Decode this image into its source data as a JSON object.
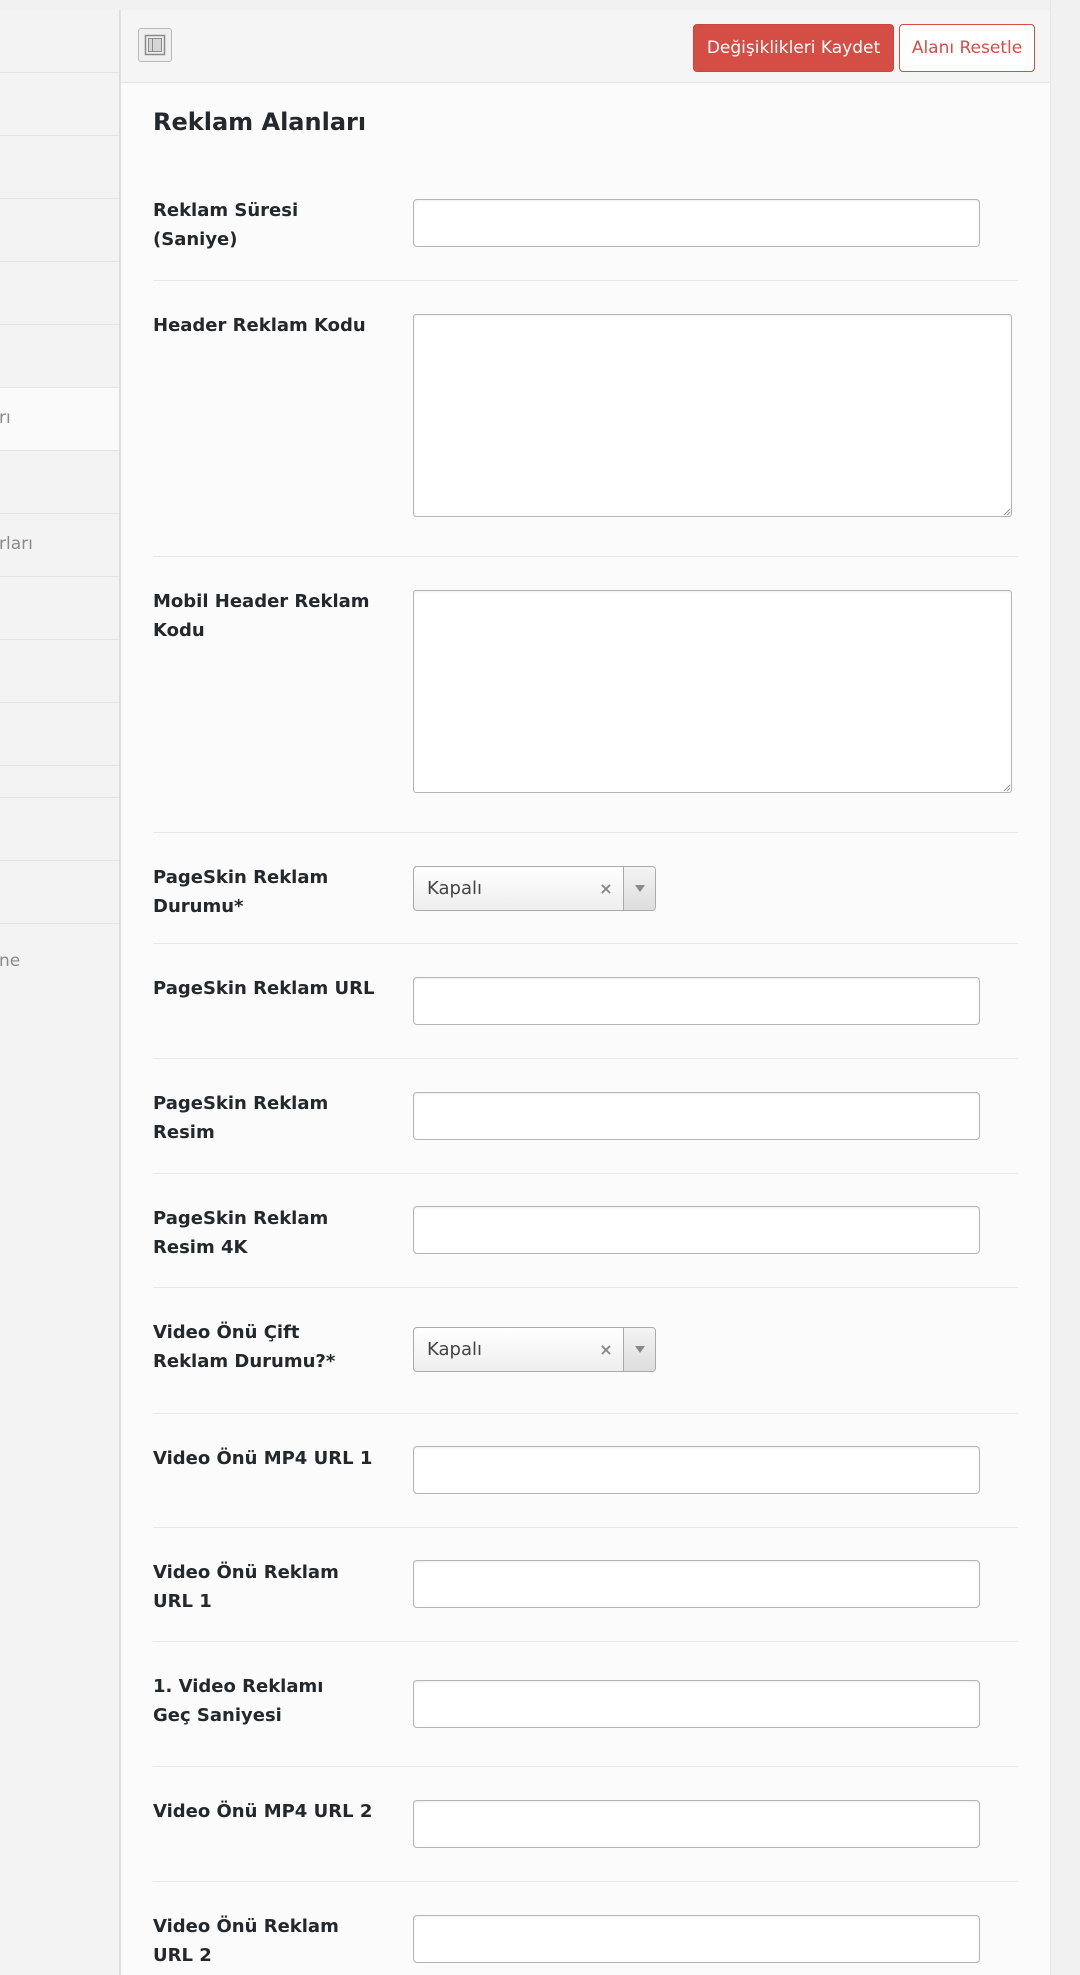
{
  "sidebar": {
    "fragments": [
      "rı",
      "rları",
      "ne"
    ]
  },
  "toolbar": {
    "save_label": "Değişiklikleri Kaydet",
    "reset_label": "Alanı Resetle"
  },
  "section": {
    "title": "Reklam Alanları"
  },
  "fields": {
    "reklam_suresi": {
      "label": "Reklam Süresi (Saniye)",
      "value": ""
    },
    "header_kod": {
      "label": "Header Reklam Kodu",
      "value": ""
    },
    "mobil_header_kod": {
      "label": "Mobil Header Reklam Kodu",
      "value": ""
    },
    "pageskin_durum": {
      "label": "PageSkin Reklam Durumu*",
      "value": "Kapalı"
    },
    "pageskin_url": {
      "label": "PageSkin Reklam URL",
      "value": ""
    },
    "pageskin_resim": {
      "label": "PageSkin Reklam Resim",
      "value": ""
    },
    "pageskin_resim_4k": {
      "label": "PageSkin Reklam Resim 4K",
      "value": ""
    },
    "video_cift_durum": {
      "label": "Video Önü Çift Reklam Durumu?*",
      "value": "Kapalı"
    },
    "video_mp4_1": {
      "label": "Video Önü MP4 URL 1",
      "value": ""
    },
    "video_reklam_url_1": {
      "label": "Video Önü Reklam URL 1",
      "value": ""
    },
    "video_gec_1": {
      "label": "1. Video Reklamı Geç Saniyesi",
      "value": ""
    },
    "video_mp4_2": {
      "label": "Video Önü MP4 URL 2",
      "value": ""
    },
    "video_reklam_url_2": {
      "label": "Video Önü Reklam URL 2",
      "value": ""
    }
  },
  "icons": {
    "layout_toggle": "layout-toggle-icon",
    "select_clear": "×",
    "select_arrow": "chevron-down-icon"
  },
  "colors": {
    "primary": "#d54e45",
    "label": "#23282d",
    "border": "#b5b5b5"
  }
}
